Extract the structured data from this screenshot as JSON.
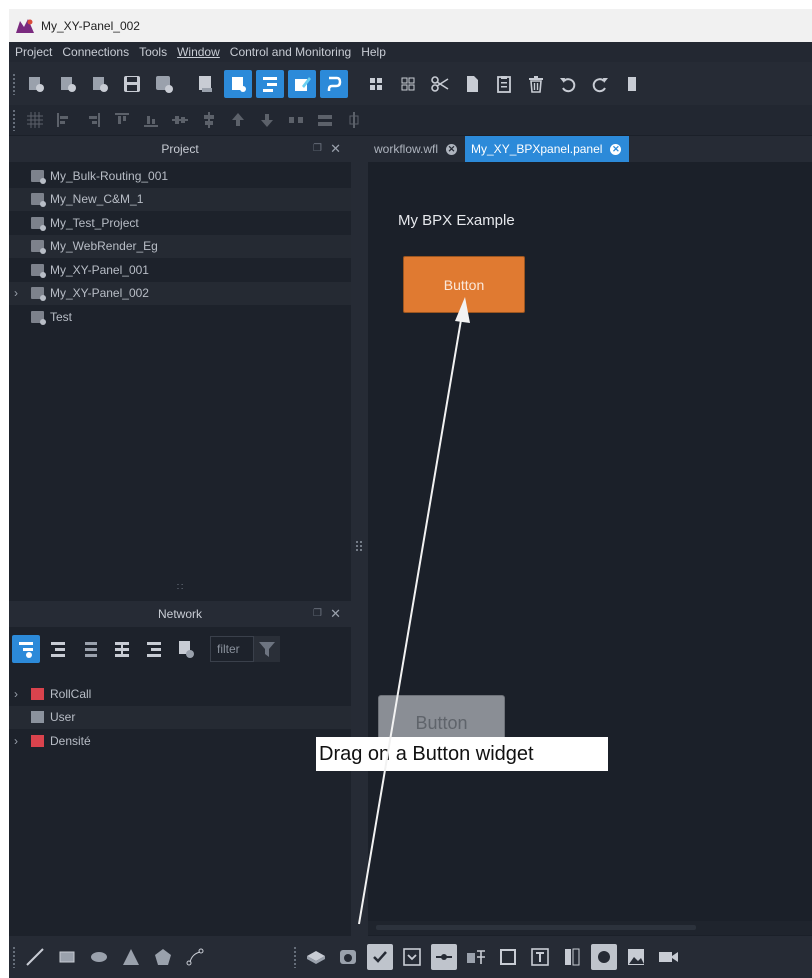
{
  "window": {
    "title": "My_XY-Panel_002",
    "app_icon": "app-logo-icon"
  },
  "menu": [
    "Project",
    "Connections",
    "Tools",
    "Window",
    "Control and Monitoring",
    "Help"
  ],
  "project_panel": {
    "title": "Project",
    "items": [
      {
        "label": "My_Bulk-Routing_001"
      },
      {
        "label": "My_New_C&M_1"
      },
      {
        "label": "My_Test_Project"
      },
      {
        "label": "My_WebRender_Eg"
      },
      {
        "label": "My_XY-Panel_001"
      },
      {
        "label": "My_XY-Panel_002"
      },
      {
        "label": "Test"
      }
    ]
  },
  "network_panel": {
    "title": "Network",
    "filter_placeholder": "filter",
    "items": [
      {
        "label": "RollCall"
      },
      {
        "label": "User"
      },
      {
        "label": "Densité"
      }
    ]
  },
  "tabs": [
    {
      "label": "workflow.wfl"
    },
    {
      "label": "My_XY_BPXpanel.panel"
    }
  ],
  "canvas": {
    "title": "My BPX Example",
    "button_label": "Button"
  },
  "drag": {
    "ghost_label": "Button",
    "callout": "Drag on a Button widget"
  },
  "colors": {
    "accent": "#2c8ad9",
    "button": "#e07a31",
    "background": "#1b2029"
  }
}
